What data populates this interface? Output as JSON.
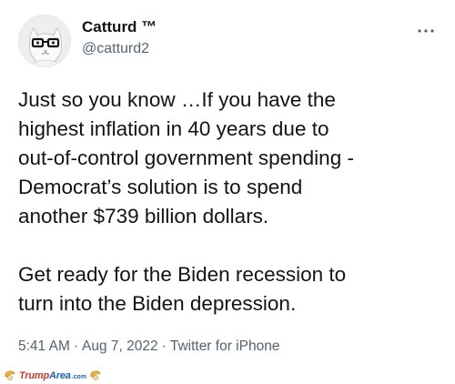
{
  "tweet": {
    "author": {
      "display_name": "Catturd ™",
      "handle": "@catturd2",
      "avatar_icon": "cat-with-glasses-avatar"
    },
    "more_icon": "ellipsis-icon",
    "paragraphs": [
      [
        "Just so you know …If you have the",
        "highest inflation in 40 years due to",
        "out-of-control government spending -",
        "Democrat’s solution is to spend",
        "another $739 billion dollars."
      ],
      [
        "Get ready for the Biden recession to",
        "turn into the Biden depression."
      ]
    ],
    "meta": {
      "time": "5:41 AM",
      "separator": "·",
      "date": "Aug 7, 2022",
      "source": "Twitter for iPhone"
    }
  },
  "watermark": {
    "part1": "Trump",
    "part2": "Area",
    "part3": ".com"
  },
  "colors": {
    "text_primary": "#0f1419",
    "text_secondary": "#536471",
    "watermark_red": "#d03a2b",
    "watermark_blue": "#1e5fb3"
  }
}
